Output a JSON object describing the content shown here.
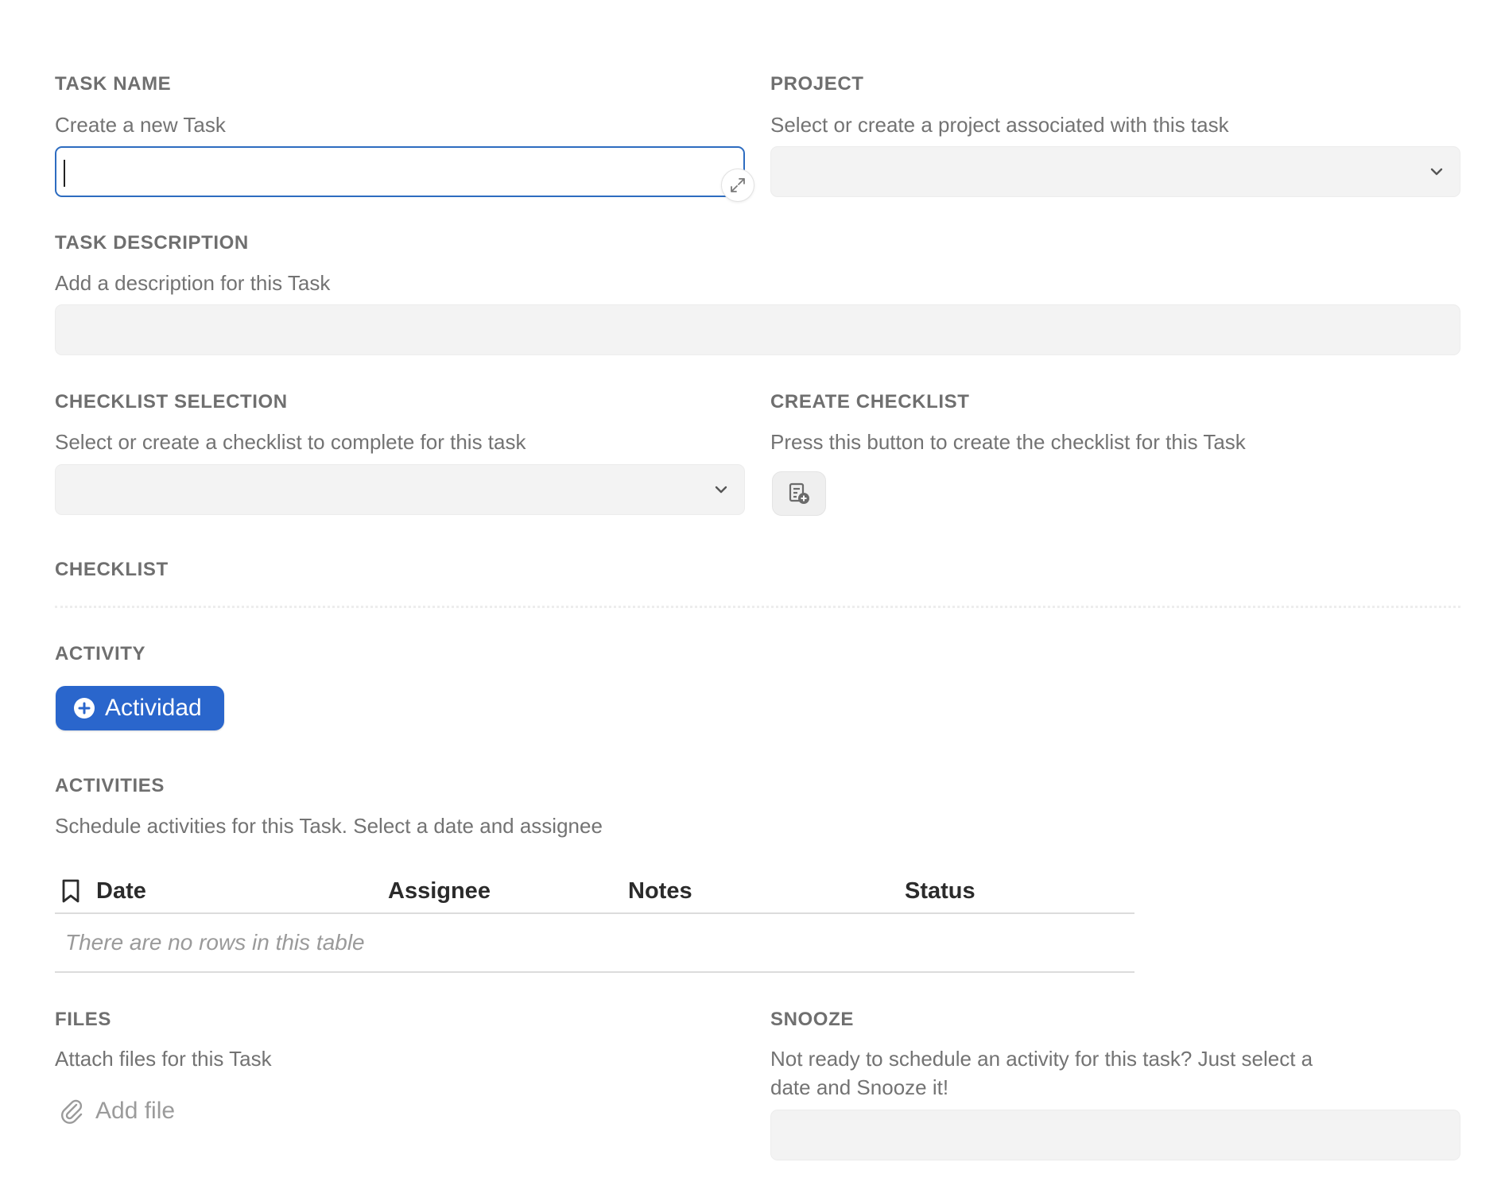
{
  "task_name": {
    "label": "TASK NAME",
    "help": "Create a new Task",
    "value": ""
  },
  "project": {
    "label": "PROJECT",
    "help": "Select or create a project associated with this task",
    "value": ""
  },
  "task_description": {
    "label": "TASK DESCRIPTION",
    "help": "Add a description for this Task",
    "value": ""
  },
  "checklist_selection": {
    "label": "CHECKLIST SELECTION",
    "help": "Select or create a checklist to complete for this task",
    "value": ""
  },
  "create_checklist": {
    "label": "CREATE CHECKLIST",
    "help": "Press this button to create the checklist for this Task"
  },
  "checklist": {
    "label": "CHECKLIST"
  },
  "activity": {
    "label": "ACTIVITY",
    "button_label": "Actividad"
  },
  "activities": {
    "label": "ACTIVITIES",
    "help": "Schedule activities for this Task. Select a date and assignee",
    "columns": [
      "Date",
      "Assignee",
      "Notes",
      "Status"
    ],
    "empty_text": "There are no rows in this table"
  },
  "files": {
    "label": "FILES",
    "help": "Attach files for this Task",
    "add_label": "Add file"
  },
  "snooze": {
    "label": "SNOOZE",
    "help_line1": "Not ready to schedule an activity for this task? Just select a",
    "help_line2": "date and Snooze it!",
    "value": ""
  },
  "colors": {
    "accent": "#2a66cc",
    "focus_border": "#2d6cc0",
    "field_bg": "#f3f3f3",
    "label": "#6f6f6f"
  }
}
